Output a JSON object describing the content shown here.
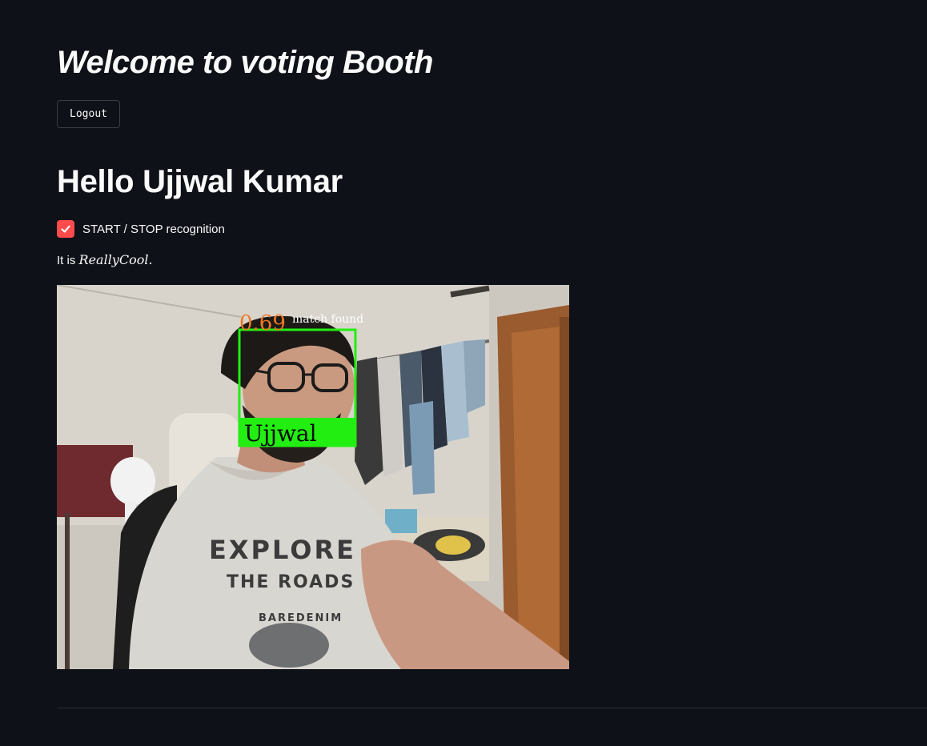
{
  "page": {
    "title": "Welcome to voting Booth",
    "logout_label": "Logout",
    "greeting": "Hello Ujjwal Kumar"
  },
  "recognition": {
    "checkbox_label": "START / STOP recognition",
    "checked": true,
    "note_prefix": "It is ",
    "note_math": "ReallyCool."
  },
  "video": {
    "confidence": "0.69",
    "status": "match found",
    "name": "Ujjwal",
    "shirt_line1": "EXPLORE",
    "shirt_line2": "THE ROADS",
    "shirt_line3": "BAREDENIM"
  },
  "colors": {
    "background": "#0e1117",
    "accent": "#ff4b4b",
    "face_box": "#22ee11",
    "confidence_text": "#ee7722"
  }
}
